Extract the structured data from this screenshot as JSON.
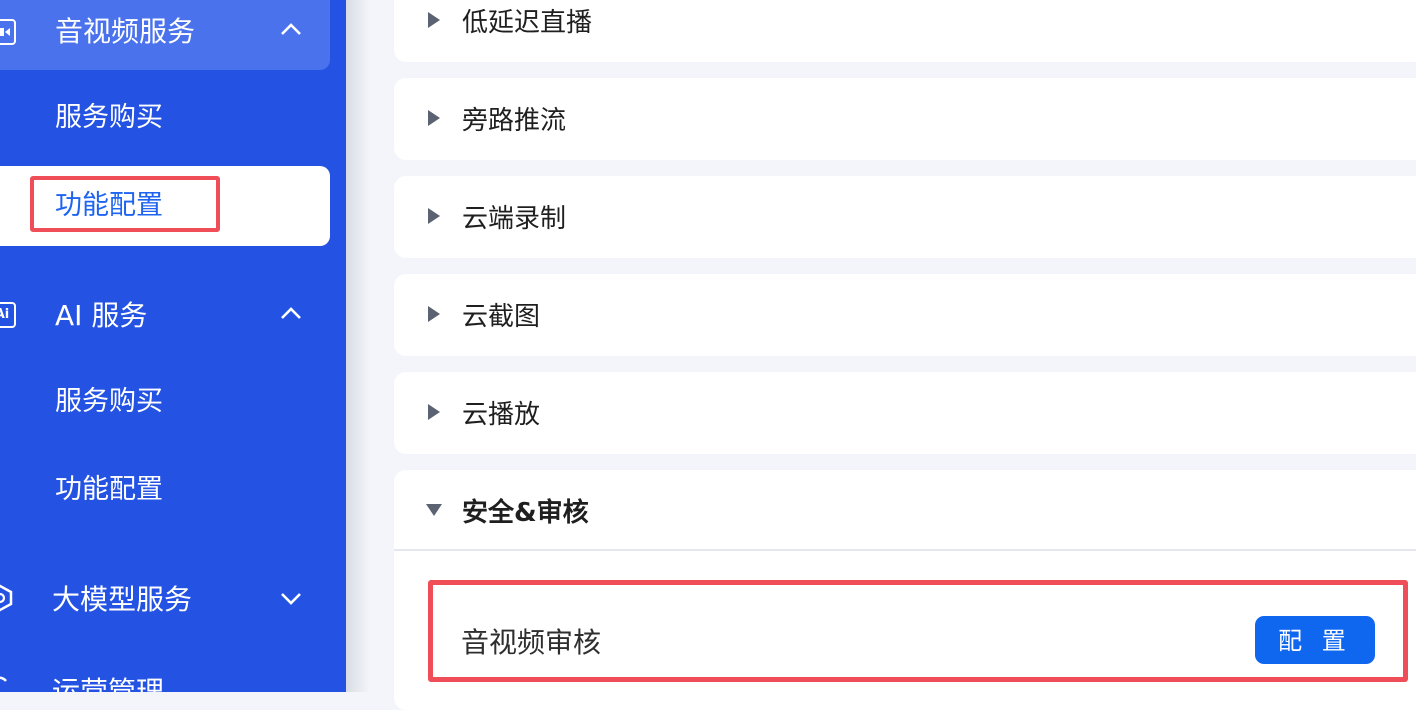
{
  "sidebar": {
    "groups": [
      {
        "label": "音视频服务",
        "icon": "video-icon",
        "expanded": true
      },
      {
        "label": "AI 服务",
        "icon": "ai-icon",
        "icon_text": "Ai",
        "expanded": true
      },
      {
        "label": "大模型服务",
        "icon": "hexagon-icon",
        "expanded": false
      },
      {
        "label": "运营管理",
        "icon": "refresh-icon"
      }
    ],
    "av_items": [
      "服务购买",
      "功能配置"
    ],
    "ai_items": [
      "服务购买",
      "功能配置"
    ]
  },
  "main": {
    "sections": [
      {
        "label": "低延迟直播",
        "expanded": false
      },
      {
        "label": "旁路推流",
        "expanded": false
      },
      {
        "label": "云端录制",
        "expanded": false
      },
      {
        "label": "云截图",
        "expanded": false
      },
      {
        "label": "云播放",
        "expanded": false
      },
      {
        "label": "安全&审核",
        "expanded": true
      }
    ],
    "feature": {
      "label": "音视频审核",
      "button_label": "配 置"
    }
  },
  "colors": {
    "sidebar_bg": "#2453e4",
    "active_group_bg": "#4a72ec",
    "selected_text": "#1e64f0",
    "highlight_border": "#ef4d57",
    "button_bg": "#1067ef"
  }
}
